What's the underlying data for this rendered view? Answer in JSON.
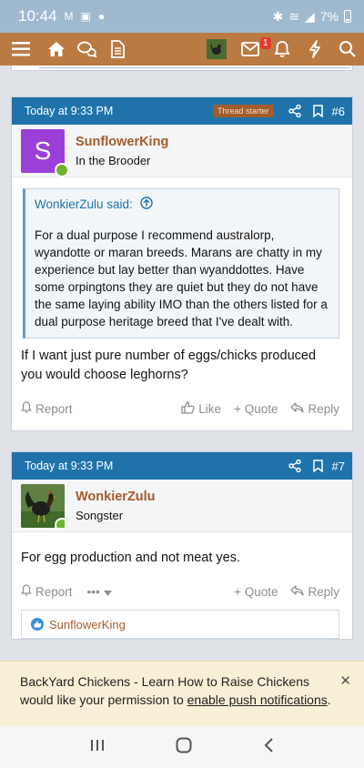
{
  "status_bar": {
    "time": "10:44",
    "battery": "7%"
  },
  "nav": {
    "icons": [
      "menu-icon",
      "home-icon",
      "chat-icon",
      "document-icon",
      "inbox-icon",
      "bell-icon",
      "bolt-icon",
      "search-icon"
    ],
    "alert_count": "1"
  },
  "posts": [
    {
      "time": "Today at 9:33 PM",
      "badge": "Thread starter",
      "number": "#6",
      "avatar_letter": "S",
      "avatar_color": "#9b3fd8",
      "username": "SunflowerKing",
      "user_title": "In the Brooder",
      "quote": {
        "author": "WonkierZulu said:",
        "text": "For a dual purpose I recommend australorp, wyandotte or maran breeds. Marans are chatty in my experience but lay better than wyanddottes. Have some orpingtons they are quiet but they do not have the same laying ability IMO than the others listed for a dual purpose heritage breed that I've dealt with."
      },
      "body": "If I want just pure number of eggs/chicks produced you would choose leghorns?",
      "actions": {
        "report": "Report",
        "like": "Like",
        "quote": "+ Quote",
        "reply": "Reply"
      }
    },
    {
      "time": "Today at 9:33 PM",
      "number": "#7",
      "username": "WonkierZulu",
      "user_title": "Songster",
      "body": "For egg production and not meat yes.",
      "actions": {
        "report": "Report",
        "more": "•••",
        "quote": "+ Quote",
        "reply": "Reply"
      },
      "reactions": "SunflowerKing"
    }
  ],
  "notice": {
    "text_before": "BackYard Chickens - Learn How to Raise Chickens would like your permission to ",
    "link": "enable push notifications",
    "text_after": "."
  },
  "colors": {
    "nav": "#bc7a43",
    "post_header": "#1f73aa",
    "username": "#a35c2c",
    "online": "#6fb52c"
  }
}
